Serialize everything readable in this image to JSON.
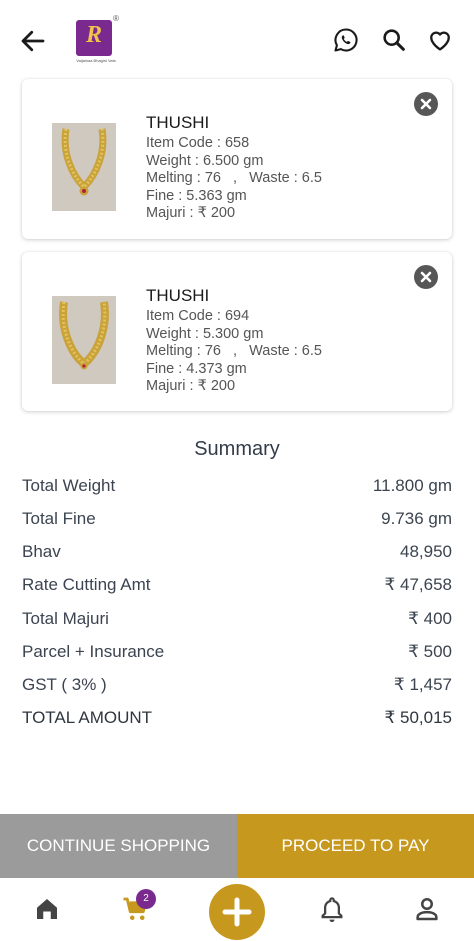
{
  "header": {
    "back_icon": "arrow-left-icon",
    "logo": {
      "letter": "R",
      "tagline": "Vaijainaa Bhagini Vats"
    },
    "icons": [
      "whatsapp-icon",
      "search-icon",
      "heart-icon"
    ]
  },
  "cart_items": [
    {
      "title": "THUSHI",
      "item_code": "Item Code : 658",
      "weight": "Weight : 6.500 gm",
      "melting_waste": "Melting : 76   ,   Waste : 6.5",
      "fine": "Fine : 5.363 gm",
      "majuri": "Majuri : ₹ 200"
    },
    {
      "title": "THUSHI",
      "item_code": "Item Code : 694",
      "weight": "Weight : 5.300 gm",
      "melting_waste": "Melting : 76   ,   Waste : 6.5",
      "fine": "Fine : 4.373 gm",
      "majuri": "Majuri : ₹ 200"
    }
  ],
  "summary": {
    "title": "Summary",
    "rows": [
      {
        "label": "Total Weight",
        "value": "11.800 gm"
      },
      {
        "label": "Total Fine",
        "value": "9.736 gm"
      },
      {
        "label": "Bhav",
        "value": "48,950"
      },
      {
        "label": "Rate Cutting Amt",
        "value": "₹ 47,658"
      },
      {
        "label": "Total Majuri",
        "value": "₹ 400"
      },
      {
        "label": "Parcel + Insurance",
        "value": "₹ 500"
      },
      {
        "label": "GST ( 3% )",
        "value": "₹ 1,457"
      },
      {
        "label": "TOTAL AMOUNT",
        "value": "₹ 50,015"
      }
    ]
  },
  "actions": {
    "continue_label": "CONTINUE SHOPPING",
    "pay_label": "PROCEED TO PAY"
  },
  "bottom_nav": {
    "cart_count": "2",
    "icons": [
      "home-icon",
      "cart-icon",
      "add-icon",
      "bell-icon",
      "profile-icon"
    ]
  },
  "colors": {
    "gold_accent": "#c7981e",
    "brand_purple": "#7a2a8f",
    "continue_gray": "#9b9b9b"
  }
}
